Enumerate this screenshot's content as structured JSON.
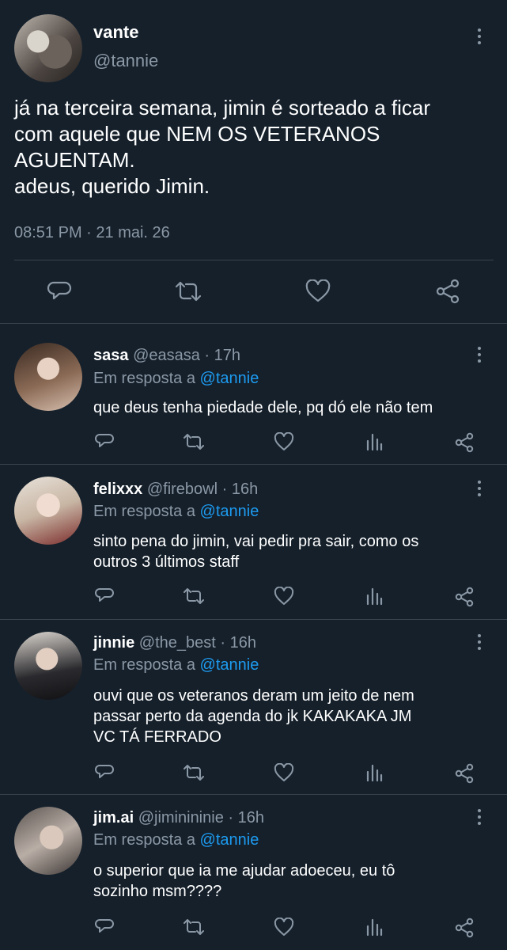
{
  "main": {
    "name": "vante",
    "handle": "@tannie",
    "text_lines": [
      "já na terceira semana, jimin é sorteado a ficar",
      "com aquele que NEM OS VETERANOS",
      "AGUENTAM.",
      "adeus, querido Jimin."
    ],
    "time": "08:51 PM",
    "date": "21 mai. 26",
    "meta_sep": " · ",
    "actions": [
      "reply-icon",
      "retweet-icon",
      "like-icon",
      "share-icon"
    ]
  },
  "replies": [
    {
      "name": "sasa",
      "handle": "@easasa",
      "age": "17h",
      "reply_prefix": "Em resposta a ",
      "reply_to": "@tannie",
      "text_lines": [
        "que deus tenha piedade dele, pq dó ele não tem"
      ]
    },
    {
      "name": "felixxx",
      "handle": "@firebowl",
      "age": "16h",
      "reply_prefix": "Em resposta a ",
      "reply_to": "@tannie",
      "text_lines": [
        "sinto pena do jimin, vai pedir pra sair, como os",
        "outros 3 últimos staff"
      ]
    },
    {
      "name": "jinnie",
      "handle": "@the_best",
      "age": "16h",
      "reply_prefix": "Em resposta a ",
      "reply_to": "@tannie",
      "text_lines": [
        "ouvi que os veteranos deram um jeito de nem",
        "passar perto da agenda do jk KAKAKAKA JM",
        "VC TÁ FERRADO"
      ]
    },
    {
      "name": "jim.ai",
      "handle": "@jiminininie",
      "age": "16h",
      "reply_prefix": "Em resposta a ",
      "reply_to": "@tannie",
      "text_lines": [
        "o superior que ia me ajudar adoeceu, eu tô",
        "sozinho msm????"
      ]
    }
  ],
  "reply_actions": [
    "reply-icon",
    "retweet-icon",
    "like-icon",
    "analytics-icon",
    "share-icon"
  ],
  "sep": " · ",
  "colors": {
    "background": "#15202b",
    "text": "#ffffff",
    "muted": "#8b98a5",
    "link": "#1d9bf0",
    "border": "#38444d"
  }
}
